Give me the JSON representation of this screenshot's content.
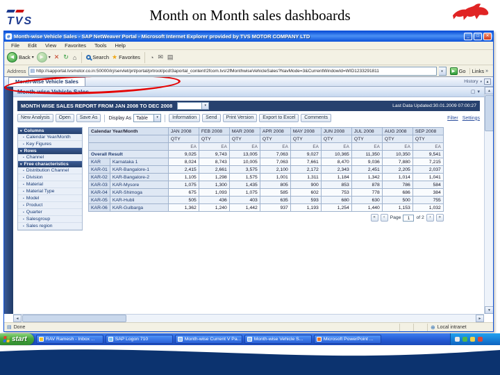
{
  "slide": {
    "title": "Month on Month sales dashboards",
    "logo_text": "TVS"
  },
  "browser": {
    "window_title": "Month-wise Vehicle Sales - SAP NetWeaver Portal - Microsoft Internet Explorer provided by TVS MOTOR COMPANY LTD",
    "menu_items": [
      "File",
      "Edit",
      "View",
      "Favorites",
      "Tools",
      "Help"
    ],
    "toolbar": {
      "back_label": "Back",
      "search_label": "Search",
      "favorites_label": "Favorites"
    },
    "address": {
      "label": "Address",
      "url": "http://sapportal.tvsmotor.co.in:50000/irj/servlet/prt/portal/prtroot/pcd!3aportal_content!2fcom.tvs!2fMonthwiseVehicleSales?NavMode=3&CurrentWindowId=WID1233291811",
      "go_label": "Go",
      "links_label": "Links"
    },
    "status": {
      "done_label": "Done",
      "zone_label": "Local intranet"
    }
  },
  "portal": {
    "tab_title": "Month-wise Vehicle Sales",
    "history_label": "History",
    "page_title": "Month-wise Vehicle Sales",
    "report_title": "MONTH WISE SALES REPORT FROM JAN 2008 TO DEC 2008",
    "last_updated": "Last Data Updated:30.01.2009 07:00:27",
    "buttons_left": [
      "New Analysis",
      "Open",
      "Save As"
    ],
    "display_as_label": "Display As",
    "display_as_value": "Table",
    "buttons_right": [
      "Information",
      "Send",
      "Print Version",
      "Export to Excel",
      "Comments"
    ],
    "filter_label": "Filter",
    "settings_label": "Settings"
  },
  "navpanel": {
    "sections": [
      {
        "title": "Columns",
        "items": [
          "Calendar Year/Month",
          "Key Figures"
        ]
      },
      {
        "title": "Rows",
        "items": [
          "Channel"
        ]
      },
      {
        "title": "Free characteristics",
        "items": [
          "Distribution Channel",
          "Division",
          "Material",
          "Material Type",
          "Model",
          "Product",
          "Quarter",
          "Salesgroup",
          "Sales region"
        ]
      }
    ]
  },
  "table": {
    "corner_label": "Calendar Year/Month",
    "months": [
      "JAN 2008",
      "FEB 2008",
      "MAR 2008",
      "APR 2008",
      "MAY 2008",
      "JUN 2008",
      "JUL 2008",
      "AUG 2008",
      "SEP 2008"
    ],
    "qty_label": "QTY",
    "unit_label": "EA",
    "rows": [
      {
        "code": "",
        "name": "Overall Result",
        "values": [
          "9,025",
          "9,743",
          "13,005",
          "7,063",
          "9,027",
          "10,365",
          "11,350",
          "10,350",
          "9,541"
        ]
      },
      {
        "code": "KAR",
        "name": "Karnataka 1",
        "values": [
          "8,024",
          "8,743",
          "10,005",
          "7,063",
          "7,661",
          "8,470",
          "9,036",
          "7,880",
          "7,215"
        ]
      },
      {
        "code": "KAR-01",
        "name": "KAR-Bangalore-1",
        "values": [
          "2,415",
          "2,661",
          "3,575",
          "2,100",
          "2,172",
          "2,343",
          "2,451",
          "2,205",
          "2,037"
        ]
      },
      {
        "code": "KAR-02",
        "name": "KAR-Bangalore-2",
        "values": [
          "1,105",
          "1,298",
          "1,575",
          "1,001",
          "1,311",
          "1,184",
          "1,342",
          "1,014",
          "1,041"
        ]
      },
      {
        "code": "KAR-03",
        "name": "KAR-Mysore",
        "values": [
          "1,075",
          "1,300",
          "1,435",
          "805",
          "900",
          "853",
          "878",
          "786",
          "584"
        ]
      },
      {
        "code": "KAR-04",
        "name": "KAR-Shimoga",
        "values": [
          "675",
          "1,093",
          "1,075",
          "585",
          "602",
          "753",
          "778",
          "686",
          "384"
        ]
      },
      {
        "code": "KAR-05",
        "name": "KAR-Hubli",
        "values": [
          "505",
          "436",
          "403",
          "635",
          "593",
          "680",
          "630",
          "500",
          "755"
        ]
      },
      {
        "code": "KAR-06",
        "name": "KAR-Gulbarga",
        "values": [
          "1,362",
          "1,240",
          "1,442",
          "937",
          "1,193",
          "1,254",
          "1,440",
          "1,153",
          "1,032"
        ]
      }
    ],
    "pagination": {
      "page_label": "Page",
      "current": "1",
      "of_label": "of 2"
    }
  },
  "taskbar": {
    "start_label": "start",
    "tasks": [
      "RAV Ramesh - Inbox ...",
      "SAP Logon 710",
      "Month-wise Current V Pa...",
      "Month-wise Vehicle S...",
      "Microsoft PowerPoint ..."
    ]
  },
  "icons": {
    "minimize": "_",
    "maximize": "□",
    "close": "✕",
    "back": "◀",
    "forward": "▶",
    "stop": "✕",
    "refresh": "↻",
    "home": "⌂",
    "favorites_star": "★",
    "caret_down": "▾",
    "go_arrow": "▶",
    "links_chevron": "»",
    "scroll_up": "▲",
    "scroll_down": "▼",
    "scroll_left": "◄",
    "scroll_right": "►",
    "page_first": "«",
    "page_prev": "‹",
    "page_next": "›",
    "page_last": "»",
    "bullet": "▪",
    "section_arrow": "▾",
    "mail": "✉",
    "print": "▤",
    "history_clock": "◔",
    "globe": "⊕",
    "page_icon": "▤",
    "window_icon": "▢",
    "ie_letter": "e"
  },
  "colors": {
    "xp_blue": "#2257d0",
    "navy": "#27416e",
    "annotation_red": "#e40000",
    "tvs_red": "#e02424"
  }
}
